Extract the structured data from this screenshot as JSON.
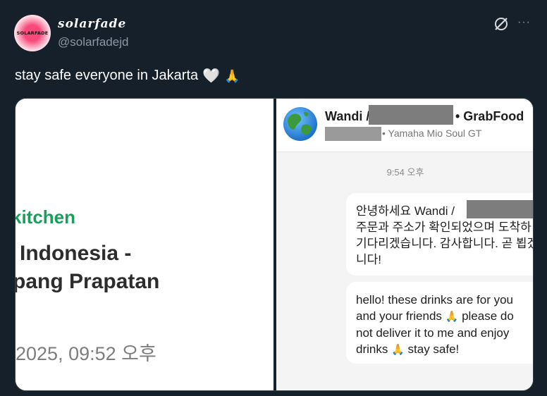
{
  "post": {
    "author": {
      "display_name": "solarfade",
      "handle": "@solarfadejd",
      "avatar_text": "SOLARFADE"
    },
    "text": "stay safe everyone in Jakarta",
    "emoji_heart": "🤍",
    "emoji_pray": "🙏",
    "icons": [
      "grok-icon",
      "more-icon"
    ],
    "more_label": "···"
  },
  "left_screenshot": {
    "kitchen_label": "kitchen",
    "store_line1": "Indonesia -",
    "store_line2": "pang Prapatan",
    "order_time": "2025, 09:52 오후",
    "accent_color": "#1a9e5c"
  },
  "right_screenshot": {
    "driver_name": "Wandi /",
    "service": "• GrabFood",
    "vehicle": "• Yamaha Mio Soul GT",
    "message_time": "9:54 오후",
    "bubble1": {
      "lines": [
        "안녕하세요 Wandi /",
        "주문과 주소가 확인되었으며 도착하",
        "기다리겠습니다. 감사합니다. 곧 뵙겠",
        "니다!"
      ]
    },
    "bubble2": {
      "line1": "hello! these drinks are for you",
      "line2_a": "and your friends",
      "line2_b": "please do",
      "line3": "not deliver it to me and enjoy",
      "line4_a": "drinks",
      "line4_b": "stay safe!",
      "pray_emoji": "🙏"
    }
  }
}
